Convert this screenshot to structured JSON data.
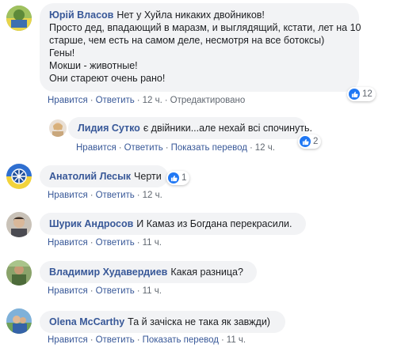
{
  "actions": {
    "like": "Нравится",
    "reply": "Ответить",
    "show_translation": "Показать перевод",
    "edited": "Отредактировано",
    "separator": "·"
  },
  "colors": {
    "author": "#385898",
    "bubble_bg": "#f2f3f5",
    "like_blue": "#2078f4",
    "meta_gray": "#606770"
  },
  "comments": [
    {
      "author": "Юрій Власов",
      "lines": [
        "Нет у Хуйла никаких двойников!",
        "Просто дед, впадающий в маразм, и выглядящий, кстати, лет на 10",
        "старше, чем есть на самом деле, несмотря на все ботоксы)",
        "Гены!",
        "Мокши - животные!",
        "Они стареют очень рано!"
      ],
      "time": "12 ч.",
      "reaction_count": "12",
      "reaction_icon": "like-icon"
    },
    {
      "author": "Лидия Сутко",
      "text": "є двійники...але нехай всі спочинуть.",
      "time": "12 ч.",
      "reaction_count": "2",
      "reaction_icon": "like-icon"
    },
    {
      "author": "Анатолий Лесык",
      "text": "Черти",
      "time": "12 ч.",
      "reaction_count": "1",
      "reaction_icon": "like-icon"
    },
    {
      "author": "Шурик Андросов",
      "text": "И Камаз из Богдана перекрасили.",
      "time": "11 ч.",
      "reaction_count": "",
      "reaction_icon": "like-icon"
    },
    {
      "author": "Владимир Худавердиев",
      "text": "Какая разница?",
      "time": "11 ч.",
      "reaction_count": "",
      "reaction_icon": "like-icon"
    },
    {
      "author": "Olena McCarthy",
      "text": "Та й зачіска не така як завжди)",
      "time": "11 ч.",
      "reaction_count": "",
      "reaction_icon": "like-icon"
    }
  ]
}
